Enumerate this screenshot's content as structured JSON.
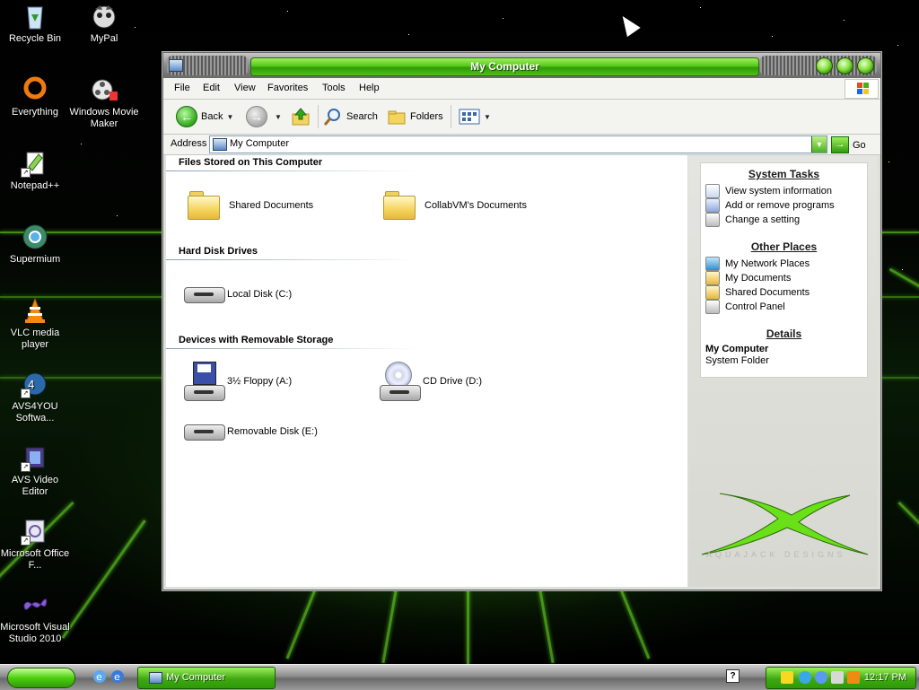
{
  "desktop": {
    "icons": [
      {
        "label": "Recycle Bin"
      },
      {
        "label": "MyPal"
      },
      {
        "label": "Everything"
      },
      {
        "label": "Windows Movie Maker"
      },
      {
        "label": "Notepad++"
      },
      {
        "label": "Supermium"
      },
      {
        "label": "VLC media player"
      },
      {
        "label": "AVS4YOU Softwa..."
      },
      {
        "label": "AVS Video Editor"
      },
      {
        "label": "Microsoft Office F..."
      },
      {
        "label": "Microsoft Visual Studio 2010"
      }
    ]
  },
  "window": {
    "title": "My Computer",
    "menu": [
      "File",
      "Edit",
      "View",
      "Favorites",
      "Tools",
      "Help"
    ],
    "toolbar": {
      "back": "Back",
      "search": "Search",
      "folders": "Folders"
    },
    "address": {
      "label": "Address",
      "value": "My Computer",
      "go": "Go"
    },
    "sections": [
      {
        "title": "Files Stored on This Computer",
        "items": [
          {
            "label": "Shared Documents",
            "icon": "folder-icon"
          },
          {
            "label": "CollabVM's Documents",
            "icon": "folder-icon"
          }
        ]
      },
      {
        "title": "Hard Disk Drives",
        "items": [
          {
            "label": "Local Disk (C:)",
            "icon": "hard-disk-icon"
          }
        ]
      },
      {
        "title": "Devices with Removable Storage",
        "items": [
          {
            "label": "3½ Floppy (A:)",
            "icon": "floppy-drive-icon"
          },
          {
            "label": "CD Drive (D:)",
            "icon": "cd-drive-icon"
          },
          {
            "label": "Removable Disk (E:)",
            "icon": "removable-disk-icon"
          }
        ]
      }
    ],
    "taskpane": {
      "system_tasks": {
        "title": "System Tasks",
        "links": [
          "View system information",
          "Add or remove programs",
          "Change a setting"
        ]
      },
      "other_places": {
        "title": "Other Places",
        "links": [
          "My Network Places",
          "My Documents",
          "Shared Documents",
          "Control Panel"
        ]
      },
      "details": {
        "title": "Details",
        "name": "My Computer",
        "type": "System Folder"
      },
      "logo_text": "AQUAJACK DESIGNS"
    }
  },
  "taskbar": {
    "task": "My Computer",
    "clock": "12:17 PM"
  },
  "colors": {
    "accent_green": "#4cc018",
    "title_text": "#ffffff"
  }
}
